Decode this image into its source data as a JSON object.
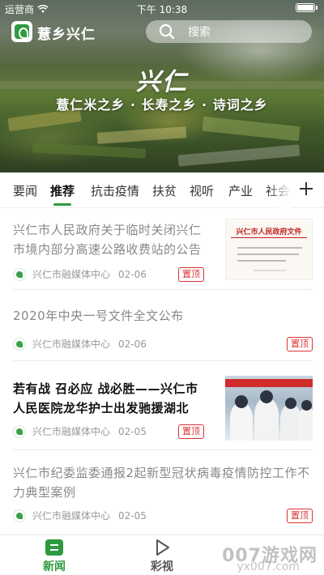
{
  "status_bar": {
    "carrier": "运营商",
    "time": "下午 10:38"
  },
  "app": {
    "name": "薏乡兴仁",
    "search_placeholder": "搜索"
  },
  "hero": {
    "calligraphy": "兴仁",
    "slogan": "薏仁米之乡 · 长寿之乡 · 诗词之乡"
  },
  "tabs": [
    "要闻",
    "推荐",
    "抗击疫情",
    "扶贫",
    "视听",
    "产业",
    "社会"
  ],
  "active_tab": "推荐",
  "news": [
    {
      "title": "兴仁市人民政府关于临时关闭兴仁市境内部分高速公路收费站的公告",
      "source": "兴仁市融媒体中心",
      "date": "02-06",
      "badge": "置顶",
      "thumb_header": "兴仁市人民政府文件"
    },
    {
      "title": "2020年中央一号文件全文公布",
      "source": "兴仁市融媒体中心",
      "date": "02-06",
      "badge": "置顶"
    },
    {
      "title": "若有战 召必应 战必胜——兴仁市人民医院龙华护士出发驰援湖北",
      "source": "兴仁市融媒体中心",
      "date": "02-05",
      "badge": "置顶"
    },
    {
      "title": "兴仁市纪委监委通报2起新型冠状病毒疫情防控工作不力典型案例",
      "source": "兴仁市融媒体中心",
      "date": "02-05",
      "badge": "置顶"
    }
  ],
  "bottom_nav": [
    {
      "label": "新闻",
      "icon": "news-icon",
      "active": true
    },
    {
      "label": "彩视",
      "icon": "play-icon",
      "active": false
    }
  ],
  "watermark": {
    "line1": "007游戏网",
    "line2": "yx007.com"
  },
  "colors": {
    "accent": "#2e9a3f",
    "badge": "#d33333"
  }
}
